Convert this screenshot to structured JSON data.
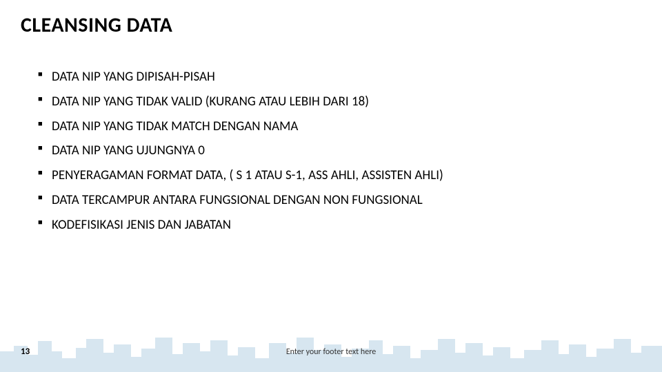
{
  "title": "CLEANSING DATA",
  "bullets": [
    "DATA NIP YANG DIPISAH-PISAH",
    "DATA NIP YANG TIDAK VALID (KURANG  ATAU LEBIH DARI 18)",
    "DATA NIP YANG TIDAK MATCH DENGAN NAMA",
    "DATA NIP YANG UJUNGNYA 0",
    "PENYERAGAMAN FORMAT DATA,  ( S 1 ATAU S-1, ASS AHLI, ASSISTEN AHLI)",
    "DATA TERCAMPUR ANTARA FUNGSIONAL DENGAN NON FUNGSIONAL",
    "KODEFISIKASI JENIS DAN JABATAN"
  ],
  "page_number": "13",
  "footer_text": "Enter your footer text here"
}
